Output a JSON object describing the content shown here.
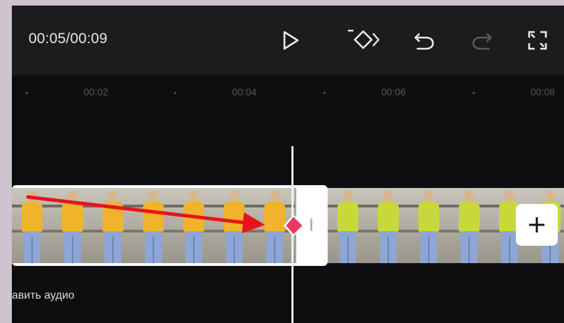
{
  "toolbar": {
    "timecode": "00:05/00:09",
    "icons": [
      "play-icon",
      "keyframe-add-icon",
      "undo-icon",
      "redo-icon",
      "fullscreen-icon"
    ]
  },
  "ruler": {
    "labels": [
      "00:02",
      "00:04",
      "00:06",
      "00:08"
    ]
  },
  "timeline": {
    "clip1_color": "#f0b32c",
    "clip2_color": "#c7d93a",
    "keyframe_color": "#e83a5f",
    "add_icon": "plus-icon"
  },
  "audio": {
    "label": "авить аудио"
  },
  "annotation": {
    "arrow_color": "#e8131a"
  }
}
